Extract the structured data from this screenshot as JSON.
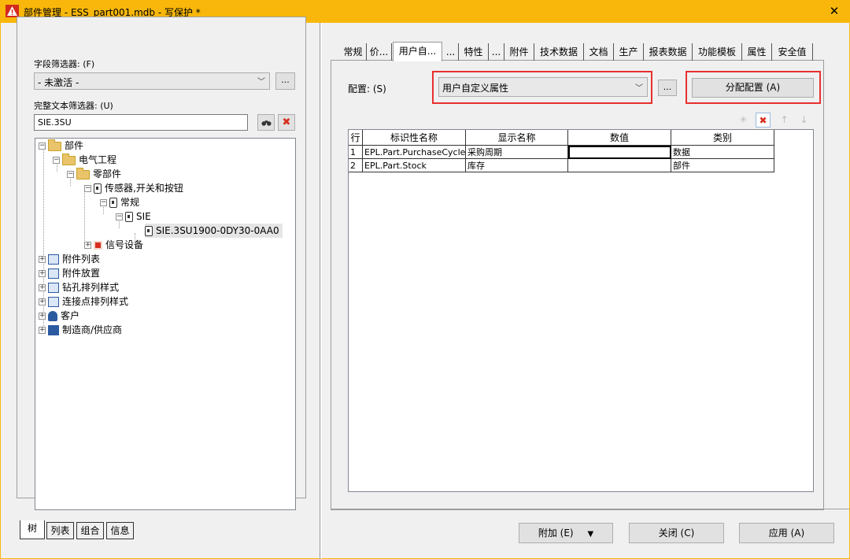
{
  "window": {
    "title": "部件管理 - ESS_part001.mdb - 写保护 *",
    "close_glyph": "✕",
    "app_icon": "warning-triangle-icon"
  },
  "left": {
    "field_filter_label": "字段筛选器: (F)",
    "field_filter_value": "- 未激活 -",
    "more_btn": "...",
    "fulltext_label": "完整文本筛选器: (U)",
    "fulltext_value": "SIE.3SU",
    "tree": [
      {
        "label": "部件"
      },
      {
        "label": "电气工程"
      },
      {
        "label": "零部件"
      },
      {
        "label": "传感器,开关和按钮"
      },
      {
        "label": "常规"
      },
      {
        "label": "SIE"
      },
      {
        "label": "SIE.3SU1900-0DY30-0AA0"
      },
      {
        "label": "信号设备"
      },
      {
        "label": "附件列表"
      },
      {
        "label": "附件放置"
      },
      {
        "label": "钻孔排列样式"
      },
      {
        "label": "连接点排列样式"
      },
      {
        "label": "客户"
      },
      {
        "label": "制造商/供应商"
      }
    ],
    "bottom_tabs": [
      "树",
      "列表",
      "组合",
      "信息"
    ]
  },
  "right": {
    "tabs": [
      "常规",
      "价...",
      "用户自...",
      "...",
      "特性",
      "...",
      "附件",
      "技术数据",
      "文档",
      "生产",
      "报表数据",
      "功能模板",
      "属性",
      "安全值"
    ],
    "config_label": "配置: (S)",
    "config_value": "用户自定义属性",
    "more_btn": "...",
    "assign_btn": "分配配置 (A)",
    "grid": {
      "headers": [
        "行",
        "标识性名称",
        "显示名称",
        "数值",
        "类别"
      ],
      "rows": [
        [
          "1",
          "EPL.Part.PurchaseCycle",
          "采购周期",
          "",
          "数据"
        ],
        [
          "2",
          "EPL.Part.Stock",
          "库存",
          "",
          "部件"
        ]
      ]
    }
  },
  "footer": {
    "add_btn": "附加 (E)",
    "close_btn": "关闭 (C)",
    "apply_btn": "应用 (A)"
  },
  "colors": {
    "titlebar": "#f8b70a",
    "highlight": "#e8302f"
  }
}
